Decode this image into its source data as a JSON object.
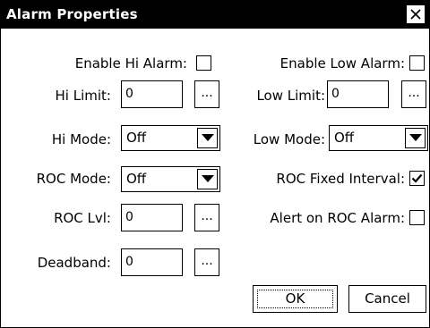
{
  "window": {
    "title": "Alarm Properties"
  },
  "labels": {
    "enable_hi_alarm": "Enable Hi Alarm:",
    "enable_low_alarm": "Enable Low Alarm:",
    "hi_limit": "Hi Limit:",
    "low_limit": "Low Limit:",
    "hi_mode": "Hi Mode:",
    "low_mode": "Low Mode:",
    "roc_mode": "ROC Mode:",
    "roc_fixed_interval": "ROC Fixed Interval:",
    "roc_lvl": "ROC Lvl:",
    "alert_on_roc_alarm": "Alert on ROC Alarm:",
    "deadband": "Deadband:"
  },
  "values": {
    "hi_limit": "0",
    "low_limit": "0",
    "roc_lvl": "0",
    "deadband": "0",
    "hi_mode": "Off",
    "low_mode": "Off",
    "roc_mode": "Off"
  },
  "checkboxes": {
    "enable_hi_alarm": false,
    "enable_low_alarm": false,
    "roc_fixed_interval": true,
    "alert_on_roc_alarm": false
  },
  "ellipsis": "...",
  "buttons": {
    "ok": "OK",
    "cancel": "Cancel"
  },
  "icons": {
    "close": "close-icon",
    "dropdown": "chevron-down-icon",
    "check": "checkmark-icon"
  }
}
